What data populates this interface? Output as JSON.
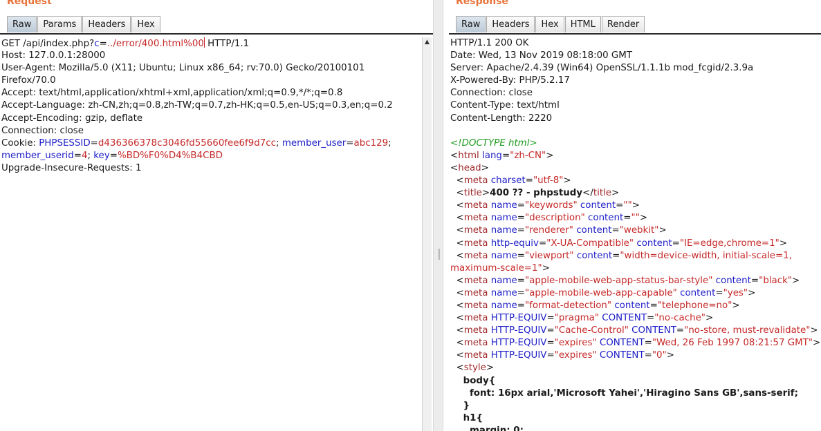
{
  "request": {
    "title": "Request",
    "tabs": [
      "Raw",
      "Params",
      "Headers",
      "Hex"
    ],
    "active_tab": "Raw",
    "lines": [
      [
        {
          "t": "GET /api/index.php?"
        },
        {
          "t": "c",
          "c": "k"
        },
        {
          "t": "="
        },
        {
          "t": "../error/400.html%00",
          "c": "v"
        },
        {
          "caret": true
        },
        {
          "t": " HTTP/1.1"
        }
      ],
      [
        {
          "t": "Host: 127.0.0.1:28000"
        }
      ],
      [
        {
          "t": "User-Agent: Mozilla/5.0 (X11; Ubuntu; Linux x86_64; rv:70.0) Gecko/20100101"
        }
      ],
      [
        {
          "t": "Firefox/70.0"
        }
      ],
      [
        {
          "t": "Accept: text/html,application/xhtml+xml,application/xml;q=0.9,*/*;q=0.8"
        }
      ],
      [
        {
          "t": "Accept-Language: zh-CN,zh;q=0.8,zh-TW;q=0.7,zh-HK;q=0.5,en-US;q=0.3,en;q=0.2"
        }
      ],
      [
        {
          "t": "Accept-Encoding: gzip, deflate"
        }
      ],
      [
        {
          "t": "Connection: close"
        }
      ],
      [
        {
          "t": "Cookie: "
        },
        {
          "t": "PHPSESSID",
          "c": "k"
        },
        {
          "t": "="
        },
        {
          "t": "d436366378c3046fd55660fee6f9d7cc",
          "c": "v"
        },
        {
          "t": "; "
        },
        {
          "t": "member_user",
          "c": "k"
        },
        {
          "t": "="
        },
        {
          "t": "abc129",
          "c": "v"
        },
        {
          "t": ";"
        }
      ],
      [
        {
          "t": "member_userid",
          "c": "k"
        },
        {
          "t": "="
        },
        {
          "t": "4",
          "c": "v"
        },
        {
          "t": "; "
        },
        {
          "t": "key",
          "c": "k"
        },
        {
          "t": "="
        },
        {
          "t": "%BD%F0%D4%B4CBD",
          "c": "v"
        }
      ],
      [
        {
          "t": "Upgrade-Insecure-Requests: 1"
        }
      ]
    ]
  },
  "response": {
    "title": "Response",
    "tabs": [
      "Raw",
      "Headers",
      "Hex",
      "HTML",
      "Render"
    ],
    "active_tab": "Raw",
    "lines": [
      [
        {
          "t": "HTTP/1.1 200 OK"
        }
      ],
      [
        {
          "t": "Date: Wed, 13 Nov 2019 08:18:00 GMT"
        }
      ],
      [
        {
          "t": "Server: Apache/2.4.39 (Win64) OpenSSL/1.1.1b mod_fcgid/2.3.9a"
        }
      ],
      [
        {
          "t": "X-Powered-By: PHP/5.2.17"
        }
      ],
      [
        {
          "t": "Connection: close"
        }
      ],
      [
        {
          "t": "Content-Type: text/html"
        }
      ],
      [
        {
          "t": "Content-Length: 2220"
        }
      ],
      [
        {
          "t": ""
        }
      ],
      [
        {
          "t": "<!DOCTYPE html>",
          "c": "cm"
        }
      ],
      [
        {
          "t": "<"
        },
        {
          "t": "html",
          "c": "tagc"
        },
        {
          "t": " "
        },
        {
          "t": "lang",
          "c": "k"
        },
        {
          "t": "="
        },
        {
          "t": "\"zh-CN\"",
          "c": "v"
        },
        {
          "t": ">"
        }
      ],
      [
        {
          "t": "<"
        },
        {
          "t": "head",
          "c": "tagc"
        },
        {
          "t": ">"
        }
      ],
      [
        {
          "t": "  <"
        },
        {
          "t": "meta",
          "c": "tagc"
        },
        {
          "t": " "
        },
        {
          "t": "charset",
          "c": "k"
        },
        {
          "t": "="
        },
        {
          "t": "\"utf-8\"",
          "c": "v"
        },
        {
          "t": ">"
        }
      ],
      [
        {
          "t": "  <"
        },
        {
          "t": "title",
          "c": "tagc"
        },
        {
          "t": ">"
        },
        {
          "t": "400 ?? - phpstudy",
          "c": "b"
        },
        {
          "t": "</"
        },
        {
          "t": "title",
          "c": "tagc"
        },
        {
          "t": ">"
        }
      ],
      [
        {
          "t": "  <"
        },
        {
          "t": "meta",
          "c": "tagc"
        },
        {
          "t": " "
        },
        {
          "t": "name",
          "c": "k"
        },
        {
          "t": "="
        },
        {
          "t": "\"keywords\"",
          "c": "v"
        },
        {
          "t": " "
        },
        {
          "t": "content",
          "c": "k"
        },
        {
          "t": "="
        },
        {
          "t": "\"\"",
          "c": "v"
        },
        {
          "t": ">"
        }
      ],
      [
        {
          "t": "  <"
        },
        {
          "t": "meta",
          "c": "tagc"
        },
        {
          "t": " "
        },
        {
          "t": "name",
          "c": "k"
        },
        {
          "t": "="
        },
        {
          "t": "\"description\"",
          "c": "v"
        },
        {
          "t": " "
        },
        {
          "t": "content",
          "c": "k"
        },
        {
          "t": "="
        },
        {
          "t": "\"\"",
          "c": "v"
        },
        {
          "t": ">"
        }
      ],
      [
        {
          "t": "  <"
        },
        {
          "t": "meta",
          "c": "tagc"
        },
        {
          "t": " "
        },
        {
          "t": "name",
          "c": "k"
        },
        {
          "t": "="
        },
        {
          "t": "\"renderer\"",
          "c": "v"
        },
        {
          "t": " "
        },
        {
          "t": "content",
          "c": "k"
        },
        {
          "t": "="
        },
        {
          "t": "\"webkit\"",
          "c": "v"
        },
        {
          "t": ">"
        }
      ],
      [
        {
          "t": "  <"
        },
        {
          "t": "meta",
          "c": "tagc"
        },
        {
          "t": " "
        },
        {
          "t": "http-equiv",
          "c": "k"
        },
        {
          "t": "="
        },
        {
          "t": "\"X-UA-Compatible\"",
          "c": "v"
        },
        {
          "t": " "
        },
        {
          "t": "content",
          "c": "k"
        },
        {
          "t": "="
        },
        {
          "t": "\"IE=edge,chrome=1\"",
          "c": "v"
        },
        {
          "t": ">"
        }
      ],
      [
        {
          "t": "  <"
        },
        {
          "t": "meta",
          "c": "tagc"
        },
        {
          "t": " "
        },
        {
          "t": "name",
          "c": "k"
        },
        {
          "t": "="
        },
        {
          "t": "\"viewport\"",
          "c": "v"
        },
        {
          "t": " "
        },
        {
          "t": "content",
          "c": "k"
        },
        {
          "t": "="
        },
        {
          "t": "\"width=device-width, initial-scale=1,",
          "c": "v"
        }
      ],
      [
        {
          "t": "maximum-scale=1\"",
          "c": "v"
        },
        {
          "t": ">"
        }
      ],
      [
        {
          "t": "  <"
        },
        {
          "t": "meta",
          "c": "tagc"
        },
        {
          "t": " "
        },
        {
          "t": "name",
          "c": "k"
        },
        {
          "t": "="
        },
        {
          "t": "\"apple-mobile-web-app-status-bar-style\"",
          "c": "v"
        },
        {
          "t": " "
        },
        {
          "t": "content",
          "c": "k"
        },
        {
          "t": "="
        },
        {
          "t": "\"black\"",
          "c": "v"
        },
        {
          "t": ">"
        }
      ],
      [
        {
          "t": "  <"
        },
        {
          "t": "meta",
          "c": "tagc"
        },
        {
          "t": " "
        },
        {
          "t": "name",
          "c": "k"
        },
        {
          "t": "="
        },
        {
          "t": "\"apple-mobile-web-app-capable\"",
          "c": "v"
        },
        {
          "t": " "
        },
        {
          "t": "content",
          "c": "k"
        },
        {
          "t": "="
        },
        {
          "t": "\"yes\"",
          "c": "v"
        },
        {
          "t": ">"
        }
      ],
      [
        {
          "t": "  <"
        },
        {
          "t": "meta",
          "c": "tagc"
        },
        {
          "t": " "
        },
        {
          "t": "name",
          "c": "k"
        },
        {
          "t": "="
        },
        {
          "t": "\"format-detection\"",
          "c": "v"
        },
        {
          "t": " "
        },
        {
          "t": "content",
          "c": "k"
        },
        {
          "t": "="
        },
        {
          "t": "\"telephone=no\"",
          "c": "v"
        },
        {
          "t": ">"
        }
      ],
      [
        {
          "t": "  <"
        },
        {
          "t": "meta",
          "c": "tagc"
        },
        {
          "t": " "
        },
        {
          "t": "HTTP-EQUIV",
          "c": "k"
        },
        {
          "t": "="
        },
        {
          "t": "\"pragma\"",
          "c": "v"
        },
        {
          "t": " "
        },
        {
          "t": "CONTENT",
          "c": "k"
        },
        {
          "t": "="
        },
        {
          "t": "\"no-cache\"",
          "c": "v"
        },
        {
          "t": ">"
        }
      ],
      [
        {
          "t": "  <"
        },
        {
          "t": "meta",
          "c": "tagc"
        },
        {
          "t": " "
        },
        {
          "t": "HTTP-EQUIV",
          "c": "k"
        },
        {
          "t": "="
        },
        {
          "t": "\"Cache-Control\"",
          "c": "v"
        },
        {
          "t": " "
        },
        {
          "t": "CONTENT",
          "c": "k"
        },
        {
          "t": "="
        },
        {
          "t": "\"no-store, must-revalidate\"",
          "c": "v"
        },
        {
          "t": ">"
        }
      ],
      [
        {
          "t": "  <"
        },
        {
          "t": "meta",
          "c": "tagc"
        },
        {
          "t": " "
        },
        {
          "t": "HTTP-EQUIV",
          "c": "k"
        },
        {
          "t": "="
        },
        {
          "t": "\"expires\"",
          "c": "v"
        },
        {
          "t": " "
        },
        {
          "t": "CONTENT",
          "c": "k"
        },
        {
          "t": "="
        },
        {
          "t": "\"Wed, 26 Feb 1997 08:21:57 GMT\"",
          "c": "v"
        },
        {
          "t": ">"
        }
      ],
      [
        {
          "t": "  <"
        },
        {
          "t": "meta",
          "c": "tagc"
        },
        {
          "t": " "
        },
        {
          "t": "HTTP-EQUIV",
          "c": "k"
        },
        {
          "t": "="
        },
        {
          "t": "\"expires\"",
          "c": "v"
        },
        {
          "t": " "
        },
        {
          "t": "CONTENT",
          "c": "k"
        },
        {
          "t": "="
        },
        {
          "t": "\"0\"",
          "c": "v"
        },
        {
          "t": ">"
        }
      ],
      [
        {
          "t": "  <"
        },
        {
          "t": "style",
          "c": "tagc"
        },
        {
          "t": ">"
        }
      ],
      [
        {
          "t": "    body{",
          "c": "b"
        }
      ],
      [
        {
          "t": "      font: 16px arial,'Microsoft Yahei','Hiragino Sans GB',sans-serif;",
          "c": "b"
        }
      ],
      [
        {
          "t": "    }",
          "c": "b"
        }
      ],
      [
        {
          "t": "    h1{",
          "c": "b"
        }
      ],
      [
        {
          "t": "      margin: 0;",
          "c": "b"
        }
      ]
    ]
  }
}
